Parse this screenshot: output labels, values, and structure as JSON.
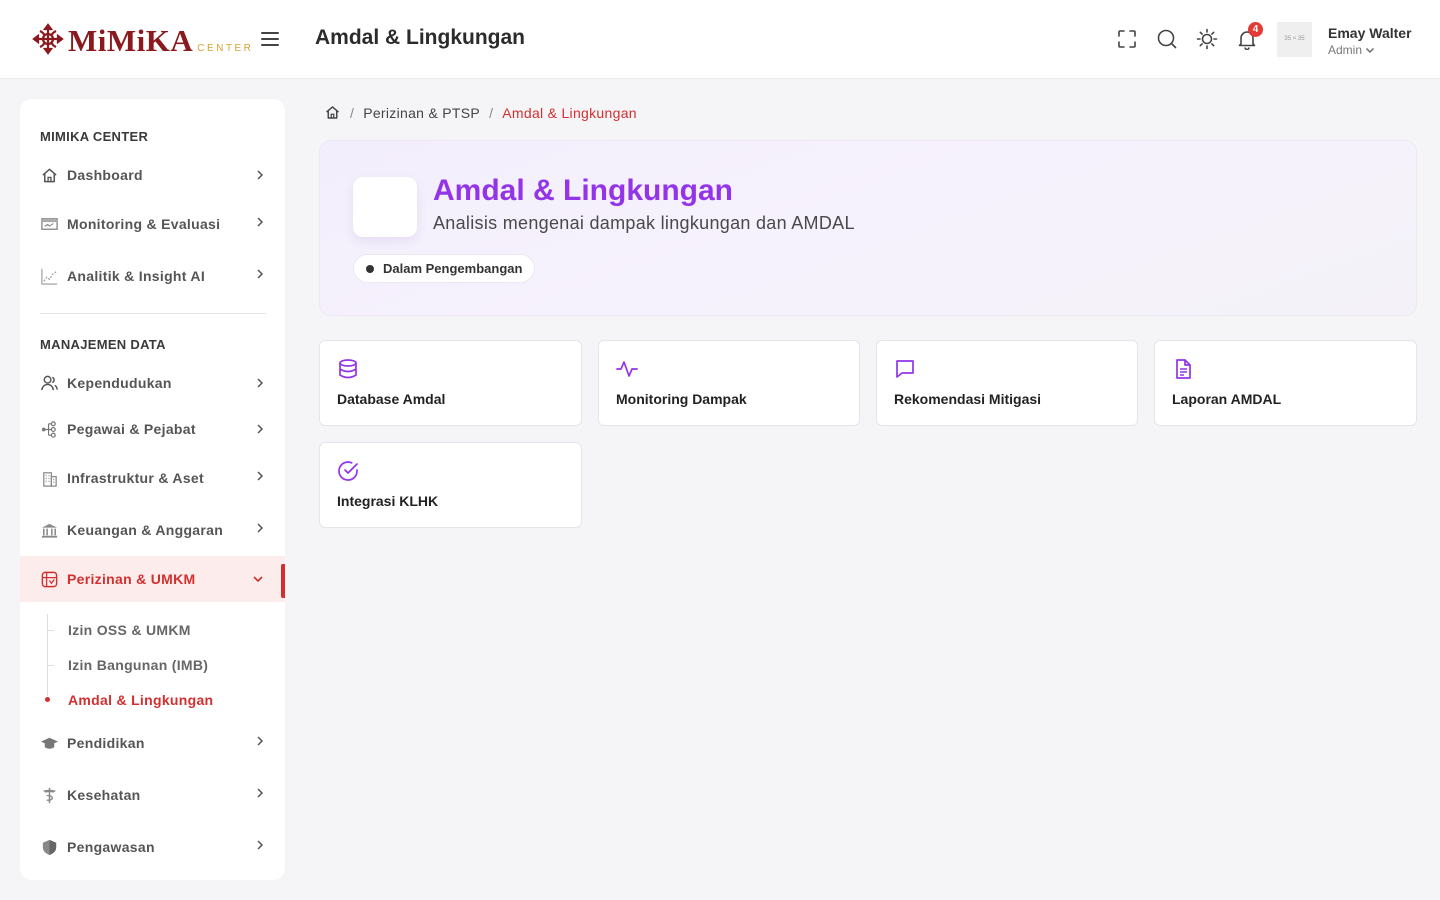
{
  "header": {
    "logo_text": "MiMiKA",
    "logo_sub": "CENTER",
    "title": "Amdal & Lingkungan",
    "notification_count": "4",
    "avatar_placeholder": "35 × 35",
    "user_name": "Emay Walter",
    "user_role": "Admin",
    "icons": [
      "fullscreen-icon",
      "search-icon",
      "theme-sun-icon",
      "bell-icon"
    ]
  },
  "sidebar": {
    "section1": "MIMIKA CENTER",
    "section2": "MANAJEMEN DATA",
    "items": [
      {
        "label": "Dashboard",
        "icon": "home-icon"
      },
      {
        "label": "Monitoring & Evaluasi",
        "icon": "monitor-icon"
      },
      {
        "label": "Analitik & Insight AI",
        "icon": "chart-icon"
      },
      {
        "label": "Kependudukan",
        "icon": "users-icon"
      },
      {
        "label": "Pegawai & Pejabat",
        "icon": "org-icon"
      },
      {
        "label": "Infrastruktur & Aset",
        "icon": "building-icon"
      },
      {
        "label": "Keuangan & Anggaran",
        "icon": "bank-icon"
      },
      {
        "label": "Perizinan & UMKM",
        "icon": "license-icon"
      },
      {
        "label": "Pendidikan",
        "icon": "graduation-icon"
      },
      {
        "label": "Kesehatan",
        "icon": "health-icon"
      },
      {
        "label": "Pengawasan",
        "icon": "shield-icon"
      }
    ],
    "subitems": [
      {
        "label": "Izin OSS & UMKM"
      },
      {
        "label": "Izin Bangunan (IMB)"
      },
      {
        "label": "Amdal & Lingkungan"
      }
    ]
  },
  "breadcrumb": {
    "parent": "Perizinan & PTSP",
    "current": "Amdal & Lingkungan"
  },
  "hero": {
    "title": "Amdal & Lingkungan",
    "subtitle": "Analisis mengenai dampak lingkungan dan AMDAL",
    "status": "Dalam Pengembangan"
  },
  "cards": [
    {
      "label": "Database Amdal",
      "icon": "database-icon"
    },
    {
      "label": "Monitoring Dampak",
      "icon": "activity-icon"
    },
    {
      "label": "Rekomendasi Mitigasi",
      "icon": "message-icon"
    },
    {
      "label": "Laporan AMDAL",
      "icon": "document-icon"
    },
    {
      "label": "Integrasi KLHK",
      "icon": "check-circle-icon"
    }
  ],
  "colors": {
    "brand": "#8a1a1d",
    "accent_red": "#d32f2f",
    "purple": "#9334e8",
    "logo_gold": "#d8a233"
  }
}
